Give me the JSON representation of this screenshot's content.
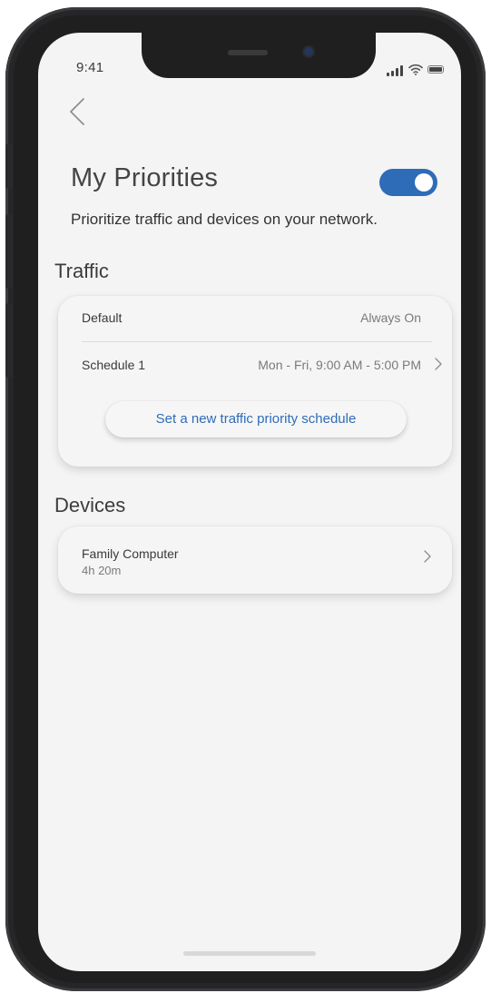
{
  "status_bar": {
    "time": "9:41",
    "icons": [
      "signal-icon",
      "wifi-icon",
      "battery-icon"
    ]
  },
  "header": {
    "back_icon": "chevron-left-icon",
    "title": "My Priorities",
    "toggle_on": true,
    "subtitle": "Prioritize traffic and devices on your network."
  },
  "traffic": {
    "section_label": "Traffic",
    "rows": [
      {
        "label": "Default",
        "value": "Always On"
      },
      {
        "label": "Schedule 1",
        "value": "Mon - Fri, 9:00 AM - 5:00 PM"
      }
    ],
    "new_schedule_label": "Set a new traffic priority schedule"
  },
  "devices": {
    "section_label": "Devices",
    "items": [
      {
        "name": "Family Computer",
        "duration": "4h 20m"
      }
    ]
  },
  "colors": {
    "accent": "#2f6cb8",
    "background": "#f4f4f4",
    "frame": "#1f1f20"
  }
}
